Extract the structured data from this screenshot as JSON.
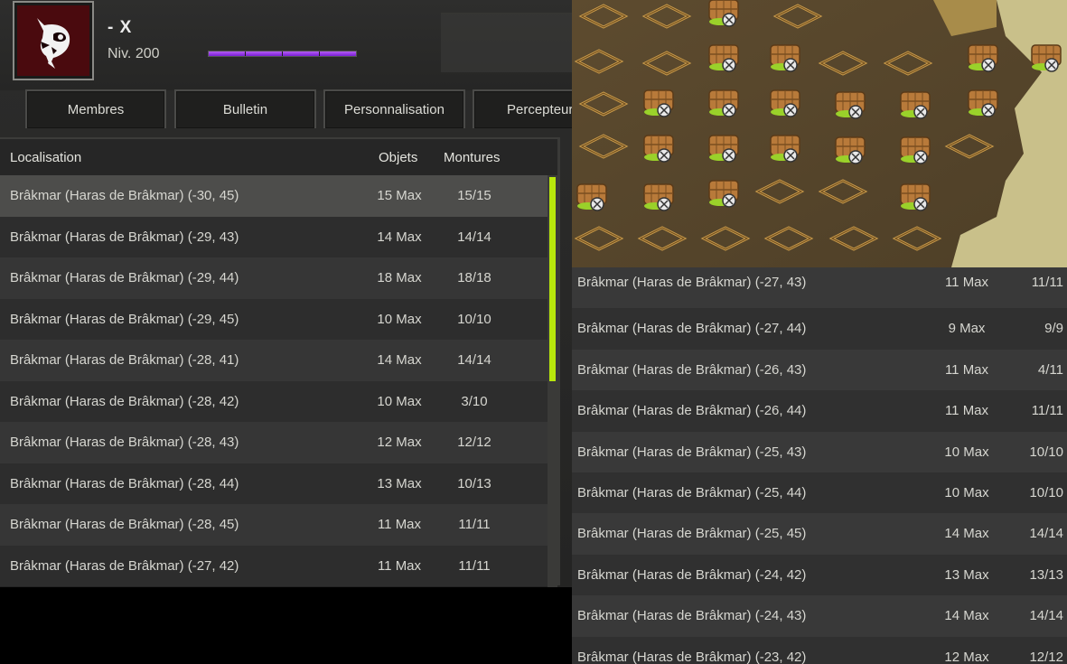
{
  "guild": {
    "name": "- X",
    "level": "Niv. 200",
    "xp_fraction": 1.0,
    "emblem_icon": "masked-face-emblem-icon"
  },
  "tabs": [
    {
      "label": "Membres"
    },
    {
      "label": "Bulletin"
    },
    {
      "label": "Personnalisation"
    },
    {
      "label": "Percepteurs"
    }
  ],
  "table": {
    "headers": {
      "location": "Localisation",
      "objects": "Objets",
      "mounts": "Montures"
    },
    "rows": [
      {
        "location": "Brâkmar (Haras de Brâkmar) (-30, 45)",
        "objects": "15 Max",
        "mounts": "15/15"
      },
      {
        "location": "Brâkmar (Haras de Brâkmar) (-29, 43)",
        "objects": "14 Max",
        "mounts": "14/14"
      },
      {
        "location": "Brâkmar (Haras de Brâkmar) (-29, 44)",
        "objects": "18 Max",
        "mounts": "18/18"
      },
      {
        "location": "Brâkmar (Haras de Brâkmar) (-29, 45)",
        "objects": "10 Max",
        "mounts": "10/10"
      },
      {
        "location": "Brâkmar (Haras de Brâkmar) (-28, 41)",
        "objects": "14 Max",
        "mounts": "14/14"
      },
      {
        "location": "Brâkmar (Haras de Brâkmar) (-28, 42)",
        "objects": "10 Max",
        "mounts": "3/10"
      },
      {
        "location": "Brâkmar (Haras de Brâkmar) (-28, 43)",
        "objects": "12 Max",
        "mounts": "12/12"
      },
      {
        "location": "Brâkmar (Haras de Brâkmar) (-28, 44)",
        "objects": "13 Max",
        "mounts": "10/13"
      },
      {
        "location": "Brâkmar (Haras de Brâkmar) (-28, 45)",
        "objects": "11 Max",
        "mounts": "11/11"
      },
      {
        "location": "Brâkmar (Haras de Brâkmar) (-27, 42)",
        "objects": "11 Max",
        "mounts": "11/11"
      }
    ],
    "selected_index": 0
  },
  "right_table": {
    "rows": [
      {
        "location": "Brâkmar (Haras de Brâkmar) (-27, 43)",
        "objects": "11 Max",
        "mounts": "11/11"
      },
      {
        "location": "Brâkmar (Haras de Brâkmar) (-27, 44)",
        "objects": "9 Max",
        "mounts": "9/9"
      },
      {
        "location": "Brâkmar (Haras de Brâkmar) (-26, 43)",
        "objects": "11 Max",
        "mounts": "4/11"
      },
      {
        "location": "Brâkmar (Haras de Brâkmar) (-26, 44)",
        "objects": "11 Max",
        "mounts": "11/11"
      },
      {
        "location": "Brâkmar (Haras de Brâkmar) (-25, 43)",
        "objects": "10 Max",
        "mounts": "10/10"
      },
      {
        "location": "Brâkmar (Haras de Brâkmar) (-25, 44)",
        "objects": "10 Max",
        "mounts": "10/10"
      },
      {
        "location": "Brâkmar (Haras de Brâkmar) (-25, 45)",
        "objects": "14 Max",
        "mounts": "14/14"
      },
      {
        "location": "Brâkmar (Haras de Brâkmar) (-24, 42)",
        "objects": "13 Max",
        "mounts": "13/13"
      },
      {
        "location": "Brâkmar (Haras de Brâkmar) (-24, 43)",
        "objects": "14 Max",
        "mounts": "14/14"
      },
      {
        "location": "Brâkmar (Haras de Brâkmar) (-23, 42)",
        "objects": "12 Max",
        "mounts": "12/12"
      }
    ]
  },
  "map": {
    "paddock_icon": "paddock-fence-icon",
    "stable_icon": "stable-barn-icon"
  },
  "colors": {
    "xp_bar": "#8b2fe0",
    "scroll_thumb": "#b9e80c",
    "emblem_bg": "#4a0a0e"
  }
}
